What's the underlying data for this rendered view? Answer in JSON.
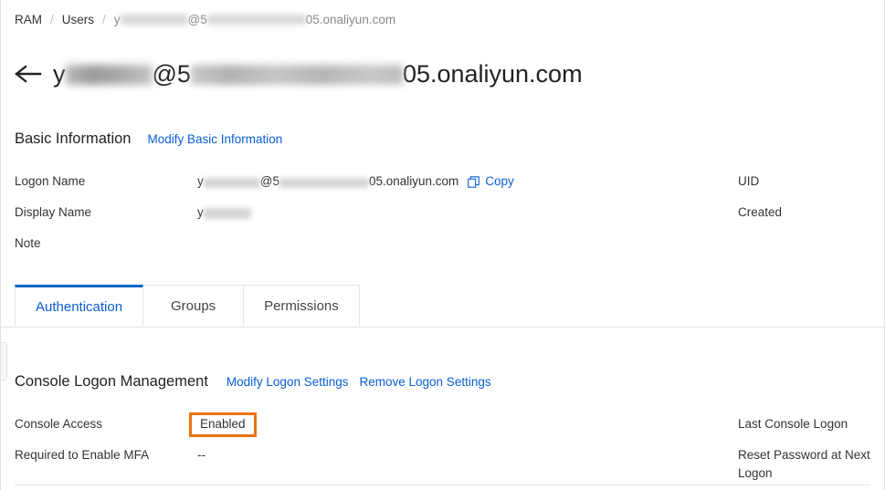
{
  "breadcrumb": {
    "items": [
      {
        "label": "RAM",
        "current": false
      },
      {
        "label": "Users",
        "current": false
      },
      {
        "label": "y…@5…05.onaliyun.com",
        "current": true
      }
    ],
    "separator": "/"
  },
  "header": {
    "back_icon": "arrow-left-icon",
    "title_prefix": "y",
    "title_middle": "@5",
    "title_suffix": "05.onaliyun.com"
  },
  "basic_information": {
    "heading": "Basic Information",
    "modify_link": "Modify Basic Information",
    "rows": [
      {
        "label": "Logon Name",
        "value_prefix": "y",
        "value_middle": "@5",
        "value_suffix": "05.onaliyun.com",
        "copy_label": "Copy",
        "copy_icon": "copy-icon"
      },
      {
        "label": "Display Name",
        "value_prefix": "y",
        "value_middle": "",
        "value_suffix": ""
      },
      {
        "label": "Note",
        "value_prefix": "",
        "value_middle": "",
        "value_suffix": ""
      }
    ],
    "right_rows": [
      {
        "label": "UID",
        "value": ""
      },
      {
        "label": "Created",
        "value": ""
      },
      {
        "label": "",
        "value": ""
      }
    ]
  },
  "tabs": [
    {
      "label": "Authentication",
      "active": true
    },
    {
      "label": "Groups",
      "active": false
    },
    {
      "label": "Permissions",
      "active": false
    }
  ],
  "console_logon": {
    "heading": "Console Logon Management",
    "modify_link": "Modify Logon Settings",
    "remove_link": "Remove Logon Settings",
    "rows": [
      {
        "label": "Console Access",
        "value": "Enabled",
        "highlighted": true
      },
      {
        "label": "Required to Enable MFA",
        "value": "--",
        "highlighted": false
      }
    ],
    "right_rows": [
      {
        "label": "Last Console Logon",
        "value": ""
      },
      {
        "label": "Reset Password at Next Logon",
        "value": ""
      }
    ]
  },
  "colors": {
    "link": "#0a5ed7",
    "tab_active_border": "#0064c8",
    "highlight": "#eb7211",
    "text": "#333333",
    "border": "#e3e4e6"
  }
}
